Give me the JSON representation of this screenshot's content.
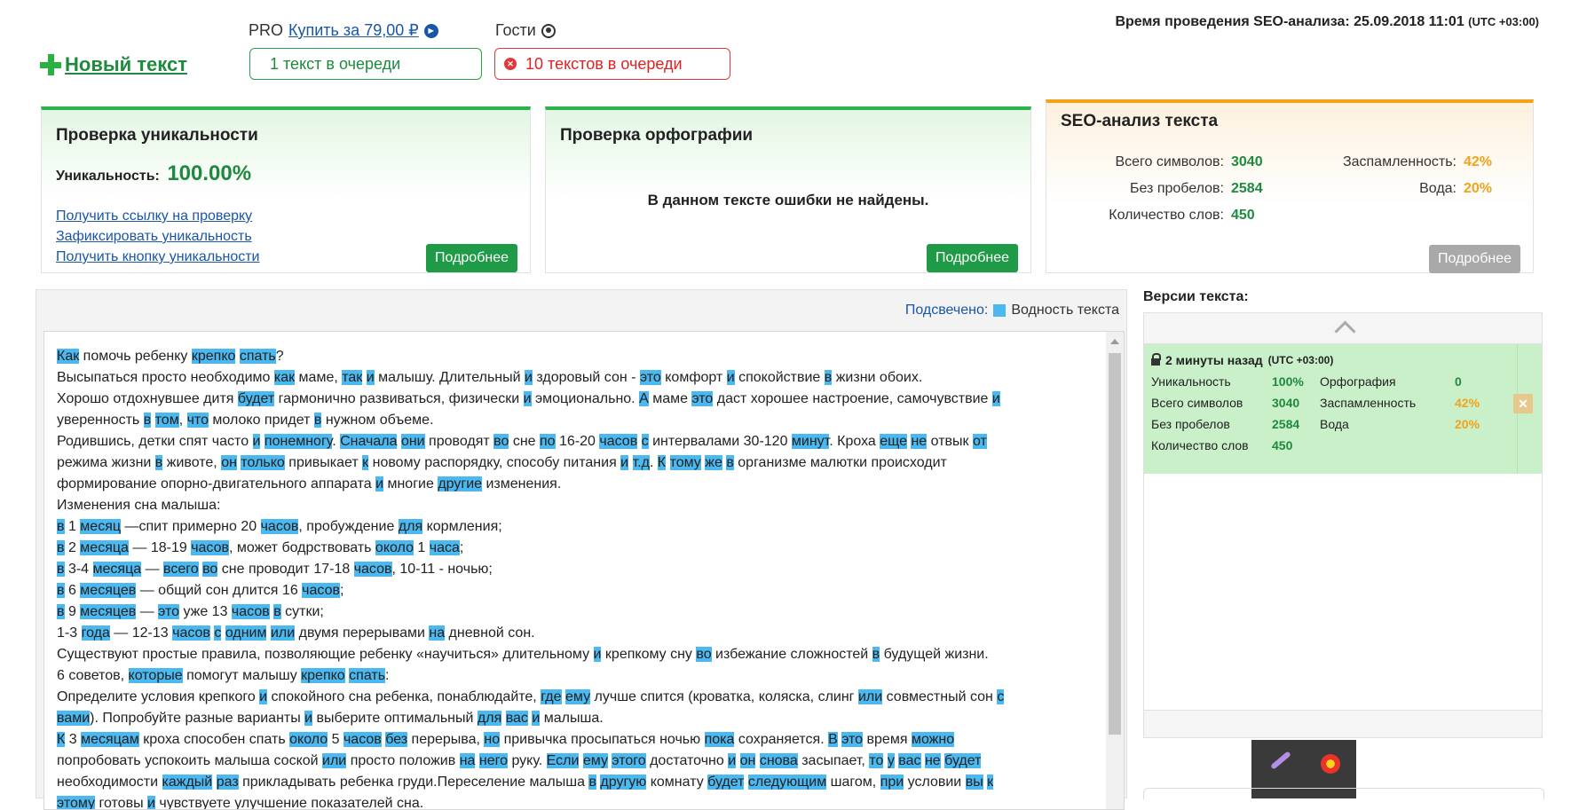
{
  "top": {
    "new_text": "Новый текст",
    "pro_label": "PRO",
    "buy_link": "Купить за 79,00 ₽",
    "guests": "Гости",
    "queue_ok": "1 текст в очереди",
    "queue_bad": "10 текстов в очереди",
    "seo_time": "Время проведения SEO-анализа: 25.09.2018 11:01",
    "seo_tz": "(UTC +03:00)"
  },
  "uniqueness": {
    "title": "Проверка уникальности",
    "label": "Уникальность:",
    "value": "100.00%",
    "links": [
      "Получить ссылку на проверку",
      "Зафиксировать уникальность",
      "Получить кнопку уникальности"
    ],
    "more": "Подробнее"
  },
  "spelling": {
    "title": "Проверка орфографии",
    "message": "В данном тексте ошибки не найдены.",
    "more": "Подробнее"
  },
  "seo": {
    "title": "SEO-анализ текста",
    "total_label": "Всего символов:",
    "total": "3040",
    "nospace_label": "Без пробелов:",
    "nospace": "2584",
    "words_label": "Количество слов:",
    "words": "450",
    "spam_label": "Заспамленность:",
    "spam": "42%",
    "water_label": "Вода:",
    "water": "20%",
    "more": "Подробнее"
  },
  "highlight": {
    "label": "Подсвечено:",
    "value": "Водность текста"
  },
  "text_lines": [
    [
      [
        "Как",
        1
      ],
      [
        " помочь ребенку ",
        0
      ],
      [
        "крепко",
        1
      ],
      [
        " ",
        0
      ],
      [
        "спать",
        1
      ],
      [
        "?",
        0
      ]
    ],
    [
      [
        "Высыпаться просто необходимо ",
        0
      ],
      [
        "как",
        1
      ],
      [
        " маме, ",
        0
      ],
      [
        "так",
        1
      ],
      [
        " ",
        0
      ],
      [
        "и",
        1
      ],
      [
        " малышу. Длительный ",
        0
      ],
      [
        "и",
        1
      ],
      [
        " здоровый сон - ",
        0
      ],
      [
        "это",
        1
      ],
      [
        " комфорт ",
        0
      ],
      [
        "и",
        1
      ],
      [
        " спокойствие ",
        0
      ],
      [
        "в",
        1
      ],
      [
        " жизни обоих.",
        0
      ]
    ],
    [
      [
        "Хорошо отдохнувшее дитя ",
        0
      ],
      [
        "будет",
        1
      ],
      [
        " гармонично развиваться, физически ",
        0
      ],
      [
        "и",
        1
      ],
      [
        " эмоционально. ",
        0
      ],
      [
        "А",
        1
      ],
      [
        " маме ",
        0
      ],
      [
        "это",
        1
      ],
      [
        " даст хорошее настроение, самочувствие ",
        0
      ],
      [
        "и",
        1
      ]
    ],
    [
      [
        "уверенность ",
        0
      ],
      [
        "в",
        1
      ],
      [
        " ",
        0
      ],
      [
        "том",
        1
      ],
      [
        ", ",
        0
      ],
      [
        "что",
        1
      ],
      [
        " молоко придет ",
        0
      ],
      [
        "в",
        1
      ],
      [
        " нужном объеме.",
        0
      ]
    ],
    [
      [
        "Родившись, детки спят часто ",
        0
      ],
      [
        "и",
        1
      ],
      [
        " ",
        0
      ],
      [
        "понемногу",
        1
      ],
      [
        ". ",
        0
      ],
      [
        "Сначала",
        1
      ],
      [
        " ",
        0
      ],
      [
        "они",
        1
      ],
      [
        " проводят ",
        0
      ],
      [
        "во",
        1
      ],
      [
        " сне ",
        0
      ],
      [
        "по",
        1
      ],
      [
        " 16-20 ",
        0
      ],
      [
        "часов",
        1
      ],
      [
        " ",
        0
      ],
      [
        "с",
        1
      ],
      [
        " интервалами 30-120 ",
        0
      ],
      [
        "минут",
        1
      ],
      [
        ". Кроха ",
        0
      ],
      [
        "еще",
        1
      ],
      [
        " ",
        0
      ],
      [
        "не",
        1
      ],
      [
        " отвык ",
        0
      ],
      [
        "от",
        1
      ]
    ],
    [
      [
        "режима жизни ",
        0
      ],
      [
        "в",
        1
      ],
      [
        " животе, ",
        0
      ],
      [
        "он",
        1
      ],
      [
        " ",
        0
      ],
      [
        "только",
        1
      ],
      [
        " привыкает ",
        0
      ],
      [
        "к",
        1
      ],
      [
        " новому распорядку, способу питания ",
        0
      ],
      [
        "и",
        1
      ],
      [
        " ",
        0
      ],
      [
        "т.д",
        1
      ],
      [
        ". ",
        0
      ],
      [
        "К",
        1
      ],
      [
        " ",
        0
      ],
      [
        "тому",
        1
      ],
      [
        " ",
        0
      ],
      [
        "же",
        1
      ],
      [
        " ",
        0
      ],
      [
        "в",
        1
      ],
      [
        " организме малютки происходит",
        0
      ]
    ],
    [
      [
        "формирование опорно-двигательного аппарата ",
        0
      ],
      [
        "и",
        1
      ],
      [
        " многие ",
        0
      ],
      [
        "другие",
        1
      ],
      [
        " изменения.",
        0
      ]
    ],
    [
      [
        "Изменения сна малыша:",
        0
      ]
    ],
    [
      [
        "в",
        1
      ],
      [
        " 1 ",
        0
      ],
      [
        "месяц",
        1
      ],
      [
        " —спит примерно 20 ",
        0
      ],
      [
        "часов",
        1
      ],
      [
        ", пробуждение ",
        0
      ],
      [
        "для",
        1
      ],
      [
        " кормления;",
        0
      ]
    ],
    [
      [
        "в",
        1
      ],
      [
        " 2 ",
        0
      ],
      [
        "месяца",
        1
      ],
      [
        " — 18-19 ",
        0
      ],
      [
        "часов",
        1
      ],
      [
        ", может бодрствовать ",
        0
      ],
      [
        "около",
        1
      ],
      [
        " 1 ",
        0
      ],
      [
        "часа",
        1
      ],
      [
        ";",
        0
      ]
    ],
    [
      [
        "в",
        1
      ],
      [
        " 3-4 ",
        0
      ],
      [
        "месяца",
        1
      ],
      [
        " — ",
        0
      ],
      [
        "всего",
        1
      ],
      [
        " ",
        0
      ],
      [
        "во",
        1
      ],
      [
        " сне проводит 17-18 ",
        0
      ],
      [
        "часов",
        1
      ],
      [
        ", 10-11 - ночью;",
        0
      ]
    ],
    [
      [
        "в",
        1
      ],
      [
        " 6 ",
        0
      ],
      [
        "месяцев",
        1
      ],
      [
        " — общий сон длится 16 ",
        0
      ],
      [
        "часов",
        1
      ],
      [
        ";",
        0
      ]
    ],
    [
      [
        "в",
        1
      ],
      [
        " 9 ",
        0
      ],
      [
        "месяцев",
        1
      ],
      [
        " — ",
        0
      ],
      [
        "это",
        1
      ],
      [
        " уже 13 ",
        0
      ],
      [
        "часов",
        1
      ],
      [
        " ",
        0
      ],
      [
        "в",
        1
      ],
      [
        " сутки;",
        0
      ]
    ],
    [
      [
        "1-3 ",
        0
      ],
      [
        "года",
        1
      ],
      [
        " — 12-13 ",
        0
      ],
      [
        "часов",
        1
      ],
      [
        " ",
        0
      ],
      [
        "с",
        1
      ],
      [
        " ",
        0
      ],
      [
        "одним",
        1
      ],
      [
        " ",
        0
      ],
      [
        "или",
        1
      ],
      [
        " двумя перерывами ",
        0
      ],
      [
        "на",
        1
      ],
      [
        " дневной сон.",
        0
      ]
    ],
    [
      [
        "Существуют простые правила, позволяющие ребенку «научиться» длительному ",
        0
      ],
      [
        "и",
        1
      ],
      [
        " крепкому сну ",
        0
      ],
      [
        "во",
        1
      ],
      [
        " избежание сложностей ",
        0
      ],
      [
        "в",
        1
      ],
      [
        " будущей жизни.",
        0
      ]
    ],
    [
      [
        "6 советов, ",
        0
      ],
      [
        "которые",
        1
      ],
      [
        " помогут малышу ",
        0
      ],
      [
        "крепко",
        1
      ],
      [
        " ",
        0
      ],
      [
        "спать",
        1
      ],
      [
        ":",
        0
      ]
    ],
    [
      [
        "Определите условия крепкого ",
        0
      ],
      [
        "и",
        1
      ],
      [
        " спокойного сна ребенка, понаблюдайте, ",
        0
      ],
      [
        "где",
        1
      ],
      [
        " ",
        0
      ],
      [
        "ему",
        1
      ],
      [
        " лучше спится (кроватка, коляска, слинг ",
        0
      ],
      [
        "или",
        1
      ],
      [
        " совместный сон ",
        0
      ],
      [
        "с",
        1
      ]
    ],
    [
      [
        "вами",
        1
      ],
      [
        "). Попробуйте разные варианты ",
        0
      ],
      [
        "и",
        1
      ],
      [
        " выберите оптимальный ",
        0
      ],
      [
        "для",
        1
      ],
      [
        " ",
        0
      ],
      [
        "вас",
        1
      ],
      [
        " ",
        0
      ],
      [
        "и",
        1
      ],
      [
        " малыша.",
        0
      ]
    ],
    [
      [
        "К",
        1
      ],
      [
        " 3 ",
        0
      ],
      [
        "месяцам",
        1
      ],
      [
        " кроха способен спать ",
        0
      ],
      [
        "около",
        1
      ],
      [
        " 5 ",
        0
      ],
      [
        "часов",
        1
      ],
      [
        " ",
        0
      ],
      [
        "без",
        1
      ],
      [
        " перерыва, ",
        0
      ],
      [
        "но",
        1
      ],
      [
        " привычка просыпаться ночью ",
        0
      ],
      [
        "пока",
        1
      ],
      [
        " сохраняется. ",
        0
      ],
      [
        "В",
        1
      ],
      [
        " ",
        0
      ],
      [
        "это",
        1
      ],
      [
        " время ",
        0
      ],
      [
        "можно",
        1
      ]
    ],
    [
      [
        "попробовать успокоить малыша соской ",
        0
      ],
      [
        "или",
        1
      ],
      [
        " просто положив ",
        0
      ],
      [
        "на",
        1
      ],
      [
        " ",
        0
      ],
      [
        "него",
        1
      ],
      [
        " руку. ",
        0
      ],
      [
        "Если",
        1
      ],
      [
        " ",
        0
      ],
      [
        "ему",
        1
      ],
      [
        " ",
        0
      ],
      [
        "этого",
        1
      ],
      [
        " достаточно ",
        0
      ],
      [
        "и",
        1
      ],
      [
        " ",
        0
      ],
      [
        "он",
        1
      ],
      [
        " ",
        0
      ],
      [
        "снова",
        1
      ],
      [
        " засыпает, ",
        0
      ],
      [
        "то",
        1
      ],
      [
        " ",
        0
      ],
      [
        "у",
        1
      ],
      [
        " ",
        0
      ],
      [
        "вас",
        1
      ],
      [
        " ",
        0
      ],
      [
        "не",
        1
      ],
      [
        " ",
        0
      ],
      [
        "будет",
        1
      ]
    ],
    [
      [
        "необходимости ",
        0
      ],
      [
        "каждый",
        1
      ],
      [
        " ",
        0
      ],
      [
        "раз",
        1
      ],
      [
        " прикладывать ребенка груди.Переселение малыша ",
        0
      ],
      [
        "в",
        1
      ],
      [
        " ",
        0
      ],
      [
        "другую",
        1
      ],
      [
        " комнату ",
        0
      ],
      [
        "будет",
        1
      ],
      [
        " ",
        0
      ],
      [
        "следующим",
        1
      ],
      [
        " шагом, ",
        0
      ],
      [
        "при",
        1
      ],
      [
        " условии ",
        0
      ],
      [
        "вы",
        1
      ],
      [
        " ",
        0
      ],
      [
        "к",
        1
      ]
    ],
    [
      [
        "этому",
        1
      ],
      [
        " готовы ",
        0
      ],
      [
        "и",
        1
      ],
      [
        " чувствуете улучшение показателей сна.",
        0
      ]
    ]
  ],
  "versions": {
    "title": "Версии текста:",
    "item": {
      "time": "2 минуты назад",
      "tz": "(UTC +03:00)",
      "uniq_label": "Уникальность",
      "uniq": "100%",
      "spell_label": "Орфография",
      "spell": "0",
      "total_label": "Всего символов",
      "total": "3040",
      "spam_label": "Заспамленность",
      "spam": "42%",
      "nospace_label": "Без пробелов",
      "nospace": "2584",
      "water_label": "Вода",
      "water": "20%",
      "words_label": "Количество слов",
      "words": "450"
    }
  },
  "colors": {
    "green": "#1e8a3e",
    "orange": "#f3a21c",
    "highlight": "#4cb8f0",
    "red": "#e23a3a"
  }
}
